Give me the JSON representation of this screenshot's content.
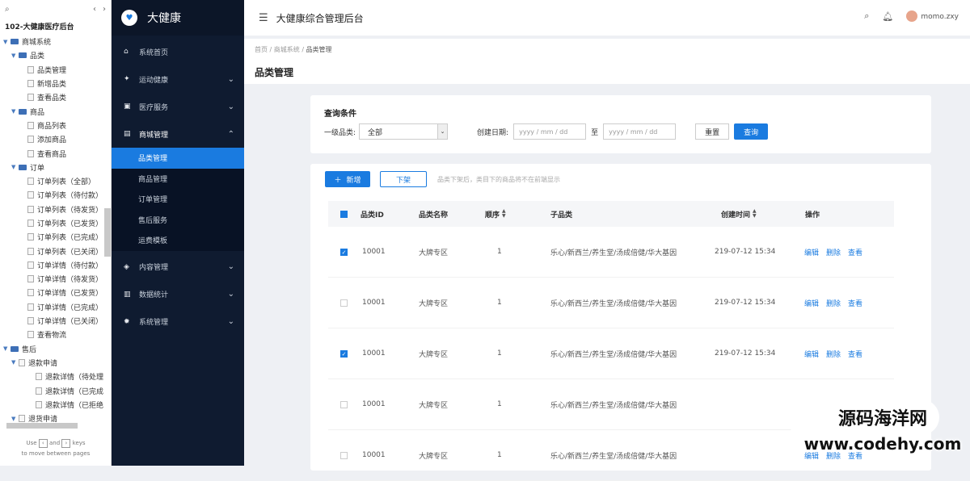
{
  "tree": {
    "project_title": "102-大健康医疗后台",
    "nav_icon": "search-icon",
    "rows": [
      {
        "level": 0,
        "type": "folder",
        "label": "商城系统",
        "open": true
      },
      {
        "level": 1,
        "type": "folder",
        "label": "品类",
        "open": true
      },
      {
        "level": 2,
        "type": "page",
        "label": "品类管理"
      },
      {
        "level": 2,
        "type": "page",
        "label": "新增品类"
      },
      {
        "level": 2,
        "type": "page",
        "label": "查看品类"
      },
      {
        "level": 1,
        "type": "folder",
        "label": "商品",
        "open": true
      },
      {
        "level": 2,
        "type": "page",
        "label": "商品列表"
      },
      {
        "level": 2,
        "type": "page",
        "label": "添加商品"
      },
      {
        "level": 2,
        "type": "page",
        "label": "查看商品"
      },
      {
        "level": 1,
        "type": "folder",
        "label": "订单",
        "open": true
      },
      {
        "level": 2,
        "type": "page",
        "label": "订单列表（全部）"
      },
      {
        "level": 2,
        "type": "page",
        "label": "订单列表（待付款）"
      },
      {
        "level": 2,
        "type": "page",
        "label": "订单列表（待发货）"
      },
      {
        "level": 2,
        "type": "page",
        "label": "订单列表（已发货）"
      },
      {
        "level": 2,
        "type": "page",
        "label": "订单列表（已完成）"
      },
      {
        "level": 2,
        "type": "page",
        "label": "订单列表（已关闭）"
      },
      {
        "level": 2,
        "type": "page",
        "label": "订单详情（待付款）"
      },
      {
        "level": 2,
        "type": "page",
        "label": "订单详情（待发货）"
      },
      {
        "level": 2,
        "type": "page",
        "label": "订单详情（已发货）"
      },
      {
        "level": 2,
        "type": "page",
        "label": "订单详情（已完成）"
      },
      {
        "level": 2,
        "type": "page",
        "label": "订单详情（已关闭）"
      },
      {
        "level": 2,
        "type": "page",
        "label": "查看物流"
      },
      {
        "level": 0,
        "type": "folder",
        "label": "售后",
        "open": true
      },
      {
        "level": 1,
        "type": "pagefolder",
        "label": "退款申请",
        "open": true
      },
      {
        "level": 3,
        "type": "page",
        "label": "退款详情（待处理"
      },
      {
        "level": 3,
        "type": "page",
        "label": "退款详情（已完成"
      },
      {
        "level": 3,
        "type": "page",
        "label": "退款详情（已拒绝"
      },
      {
        "level": 1,
        "type": "pagefolder",
        "label": "退货申请",
        "open": true
      }
    ],
    "footer_use": "Use",
    "footer_and": "and",
    "footer_keys": "keys",
    "footer_line2": "to move between pages"
  },
  "nav": {
    "brand": "大健康",
    "logo_icon": "heartbeat-icon",
    "items": [
      {
        "label": "系统首页",
        "icon": "home-icon",
        "glyph": "⌂",
        "chevron": ""
      },
      {
        "label": "运动健康",
        "icon": "run-icon",
        "glyph": "✦",
        "chevron": "⌄"
      },
      {
        "label": "医疗服务",
        "icon": "medical-icon",
        "glyph": "▣",
        "chevron": "⌄"
      },
      {
        "label": "商城管理",
        "icon": "shop-icon",
        "glyph": "▤",
        "chevron": "⌃"
      }
    ],
    "sub": [
      "品类管理",
      "商品管理",
      "订单管理",
      "售后服务",
      "运费模板"
    ],
    "items2": [
      {
        "label": "内容管理",
        "icon": "content-icon",
        "glyph": "◈",
        "chevron": "⌄"
      },
      {
        "label": "数据统计",
        "icon": "chart-icon",
        "glyph": "▥",
        "chevron": "⌄"
      },
      {
        "label": "系统管理",
        "icon": "gear-icon",
        "glyph": "✹",
        "chevron": "⌄"
      }
    ]
  },
  "header": {
    "title": "大健康综合管理后台",
    "username": "momo.zxy"
  },
  "page": {
    "crumb1": "首页",
    "crumb2": "商城系统",
    "crumb3": "品类管理",
    "title": "品类管理"
  },
  "query": {
    "title": "查询条件",
    "cat_label": "一级品类:",
    "cat_value": "全部",
    "date_label": "创建日期:",
    "date_from": "yyyy / mm / dd",
    "to": "至",
    "date_to": "yyyy / mm / dd",
    "reset": "重置",
    "search": "查询"
  },
  "list": {
    "add": "新增",
    "off": "下架",
    "hint": "品类下架后，类目下的商品将不在前端显示",
    "headers": {
      "id": "品类ID",
      "name": "品类名称",
      "order": "顺序",
      "sub": "子品类",
      "time": "创建时间",
      "ops": "操作"
    },
    "op_edit": "编辑",
    "op_del": "删除",
    "op_view": "查看",
    "rows": [
      {
        "checked": true,
        "id": "10001",
        "name": "大牌专区",
        "order": "1",
        "sub": "乐心/新西兰/养生堂/汤成倍健/华大基因",
        "time": "219-07-12 15:34"
      },
      {
        "checked": false,
        "id": "10001",
        "name": "大牌专区",
        "order": "1",
        "sub": "乐心/新西兰/养生堂/汤成倍健/华大基因",
        "time": "219-07-12 15:34"
      },
      {
        "checked": true,
        "id": "10001",
        "name": "大牌专区",
        "order": "1",
        "sub": "乐心/新西兰/养生堂/汤成倍健/华大基因",
        "time": "219-07-12 15:34"
      },
      {
        "checked": false,
        "id": "10001",
        "name": "大牌专区",
        "order": "1",
        "sub": "乐心/新西兰/养生堂/汤成倍健/华大基因",
        "time": ""
      },
      {
        "checked": false,
        "id": "10001",
        "name": "大牌专区",
        "order": "1",
        "sub": "乐心/新西兰/养生堂/汤成倍健/华大基因",
        "time": ""
      }
    ]
  },
  "watermark": {
    "line1": "源码海洋网",
    "line2": "www.codehy.com"
  },
  "colors": {
    "accent": "#1a7be0",
    "nav_bg": "#0f1b30"
  }
}
